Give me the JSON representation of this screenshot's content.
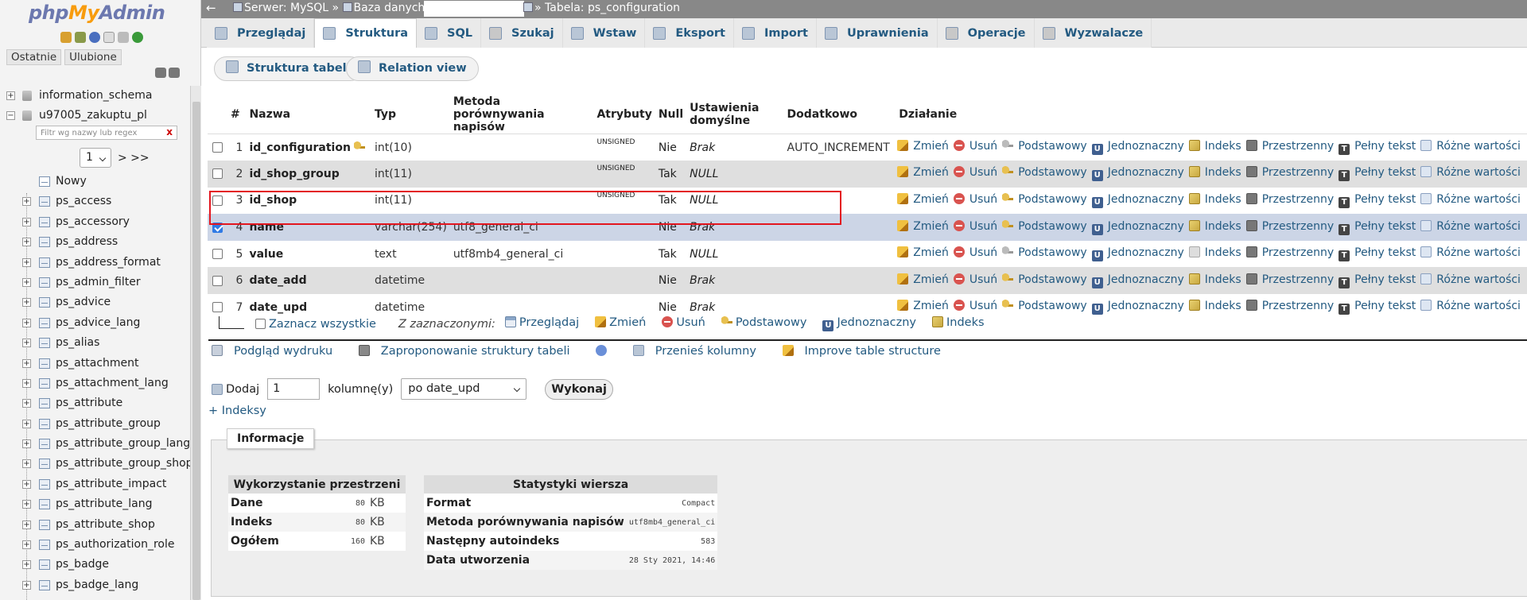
{
  "sidebar": {
    "logo": {
      "php": "php",
      "my": "My",
      "admin": "Admin"
    },
    "tabs": [
      "Ostatnie",
      "Ulubione"
    ],
    "databases": [
      {
        "name": "information_schema"
      },
      {
        "name": "u97005_zakuptu_pl"
      }
    ],
    "filter_placeholder": "Filtr wg nazwy lub regex",
    "filter_clear": "x",
    "pager": {
      "page": "1",
      "next": "> >>"
    },
    "new_label": "Nowy",
    "tables": [
      "ps_access",
      "ps_accessory",
      "ps_address",
      "ps_address_format",
      "ps_admin_filter",
      "ps_advice",
      "ps_advice_lang",
      "ps_alias",
      "ps_attachment",
      "ps_attachment_lang",
      "ps_attribute",
      "ps_attribute_group",
      "ps_attribute_group_lang",
      "ps_attribute_group_shop",
      "ps_attribute_impact",
      "ps_attribute_lang",
      "ps_attribute_shop",
      "ps_authorization_role",
      "ps_badge",
      "ps_badge_lang"
    ]
  },
  "breadcrumb": {
    "back": "←",
    "server": "Serwer: MySQL »",
    "database": "Baza danych:",
    "table": "» Tabela: ps_configuration"
  },
  "tabs": [
    "Przeglądaj",
    "Struktura",
    "SQL",
    "Szukaj",
    "Wstaw",
    "Eksport",
    "Import",
    "Uprawnienia",
    "Operacje",
    "Wyzwalacze"
  ],
  "active_tab": "Struktura",
  "subbuttons": {
    "structure": "Struktura tabeli",
    "relation": "Relation view"
  },
  "table": {
    "headers": [
      "#",
      "Nazwa",
      "Typ",
      "Metoda porównywania napisów",
      "Atrybuty",
      "Null",
      "Ustawienia domyślne",
      "Dodatkowo",
      "Działanie"
    ],
    "rows": [
      {
        "num": "1",
        "name": "id_configuration",
        "type": "int(10)",
        "collation": "",
        "attr": "UNSIGNED",
        "null": "Nie",
        "default": "Brak",
        "extra": "AUTO_INCREMENT",
        "primary": true
      },
      {
        "num": "2",
        "name": "id_shop_group",
        "type": "int(11)",
        "collation": "",
        "attr": "UNSIGNED",
        "null": "Tak",
        "default": "NULL",
        "extra": ""
      },
      {
        "num": "3",
        "name": "id_shop",
        "type": "int(11)",
        "collation": "",
        "attr": "UNSIGNED",
        "null": "Tak",
        "default": "NULL",
        "extra": ""
      },
      {
        "num": "4",
        "name": "name",
        "type": "varchar(254)",
        "collation": "utf8_general_ci",
        "attr": "",
        "null": "Nie",
        "default": "Brak",
        "extra": "",
        "checked": true
      },
      {
        "num": "5",
        "name": "value",
        "type": "text",
        "collation": "utf8mb4_general_ci",
        "attr": "",
        "null": "Tak",
        "default": "NULL",
        "extra": ""
      },
      {
        "num": "6",
        "name": "date_add",
        "type": "datetime",
        "collation": "",
        "attr": "",
        "null": "Nie",
        "default": "Brak",
        "extra": ""
      },
      {
        "num": "7",
        "name": "date_upd",
        "type": "datetime",
        "collation": "",
        "attr": "",
        "null": "Nie",
        "default": "Brak",
        "extra": ""
      }
    ],
    "actions": [
      "Zmień",
      "Usuń",
      "Podstawowy",
      "Jednoznaczny",
      "Indeks",
      "Przestrzenny",
      "Pełny tekst",
      "Różne wartości"
    ]
  },
  "with_selected": {
    "check_all": "Zaznacz wszystkie",
    "label": "Z zaznaczonymi:",
    "items": [
      "Przeglądaj",
      "Zmień",
      "Usuń",
      "Podstawowy",
      "Jednoznaczny",
      "Indeks"
    ]
  },
  "tools": {
    "print": "Podgląd wydruku",
    "propose": "Zaproponowanie struktury tabeli",
    "move": "Przenieś kolumny",
    "improve": "Improve table structure"
  },
  "add_column": {
    "label": "Dodaj",
    "count": "1",
    "columns_label": "kolumnę(y)",
    "position": "po date_upd",
    "submit": "Wykonaj"
  },
  "indexes_link": "+ Indeksy",
  "info": {
    "legend": "Informacje",
    "space": {
      "title": "Wykorzystanie przestrzeni",
      "rows": [
        {
          "label": "Dane",
          "value": "80",
          "unit": "KB"
        },
        {
          "label": "Indeks",
          "value": "80",
          "unit": "KB"
        },
        {
          "label": "Ogółem",
          "value": "160",
          "unit": "KB"
        }
      ]
    },
    "row_stats": {
      "title": "Statystyki wiersza",
      "rows": [
        {
          "label": "Format",
          "value": "Compact"
        },
        {
          "label": "Metoda porównywania napisów",
          "value": "utf8mb4_general_ci"
        },
        {
          "label": "Następny autoindeks",
          "value": "583"
        },
        {
          "label": "Data utworzenia",
          "value": "28 Sty 2021, 14:46"
        }
      ]
    }
  }
}
